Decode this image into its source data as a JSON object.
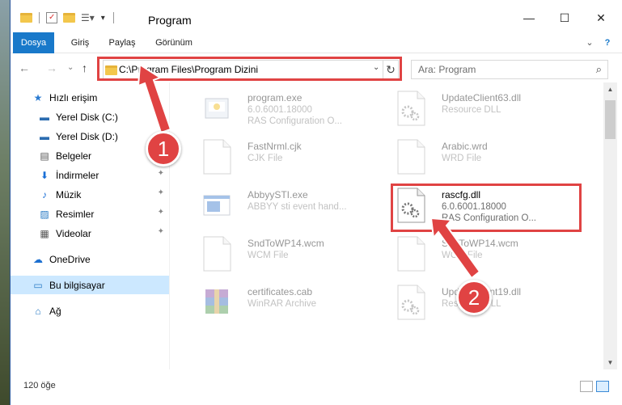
{
  "window": {
    "title": "Program",
    "minimize": "—",
    "maximize": "☐",
    "close": "✕"
  },
  "ribbon": {
    "tabs": [
      "Dosya",
      "Giriş",
      "Paylaş",
      "Görünüm"
    ],
    "expand": "⌄",
    "help": "?"
  },
  "address": {
    "path": "C:\\Program Files\\Program Dizini",
    "back": "←",
    "forward": "→",
    "recent": "⌄",
    "up": "↑",
    "refresh": "↻",
    "search_placeholder": "Ara: Program",
    "search_icon": "⌕"
  },
  "nav": {
    "items": [
      {
        "label": "Hızlı erişim",
        "icon": "★",
        "pinned": false
      },
      {
        "label": "Yerel Disk (C:)",
        "icon": "▬",
        "pinned": true
      },
      {
        "label": "Yerel Disk (D:)",
        "icon": "▬",
        "pinned": true
      },
      {
        "label": "Belgeler",
        "icon": "▤",
        "pinned": true
      },
      {
        "label": "İndirmeler",
        "icon": "⬇",
        "pinned": true
      },
      {
        "label": "Müzik",
        "icon": "♪",
        "pinned": true
      },
      {
        "label": "Resimler",
        "icon": "▨",
        "pinned": true
      },
      {
        "label": "Videolar",
        "icon": "▦",
        "pinned": true
      },
      {
        "label": "OneDrive",
        "icon": "☁",
        "pinned": false
      },
      {
        "label": "Bu bilgisayar",
        "icon": "▭",
        "pinned": false
      },
      {
        "label": "Ağ",
        "icon": "⌂",
        "pinned": false
      }
    ],
    "pin_glyph": "📌"
  },
  "files": [
    {
      "name": "program.exe",
      "line2": "6.0.6001.18000",
      "line3": "RAS Configuration O...",
      "icon": "exe",
      "faded": true
    },
    {
      "name": "UpdateClient63.dll",
      "line2": "Resource DLL",
      "line3": "",
      "icon": "dll",
      "faded": true
    },
    {
      "name": "FastNrml.cjk",
      "line2": "CJK File",
      "line3": "",
      "icon": "blank",
      "faded": true
    },
    {
      "name": "Arabic.wrd",
      "line2": "WRD File",
      "line3": "",
      "icon": "blank",
      "faded": true
    },
    {
      "name": "AbbyySTI.exe",
      "line2": "ABBYY sti event hand...",
      "line3": "",
      "icon": "app",
      "faded": true
    },
    {
      "name": "rascfg.dll",
      "line2": "6.0.6001.18000",
      "line3": "RAS Configuration O...",
      "icon": "dll",
      "faded": false
    },
    {
      "name": "SndToWP14.wcm",
      "line2": "WCM File",
      "line3": "",
      "icon": "blank",
      "faded": true
    },
    {
      "name": "SndToWP14.wcm",
      "line2": "WCM File",
      "line3": "",
      "icon": "blank",
      "faded": true
    },
    {
      "name": "certificates.cab",
      "line2": "WinRAR Archive",
      "line3": "",
      "icon": "rar",
      "faded": true
    },
    {
      "name": "UpdateClient19.dll",
      "line2": "Resource DLL",
      "line3": "",
      "icon": "dll",
      "faded": true
    }
  ],
  "status": {
    "count": "120 öğe"
  },
  "annotations": {
    "badge1": "1",
    "badge2": "2"
  },
  "colors": {
    "accent": "#1979ca",
    "highlight": "#e04343",
    "selection": "#cce8ff"
  }
}
